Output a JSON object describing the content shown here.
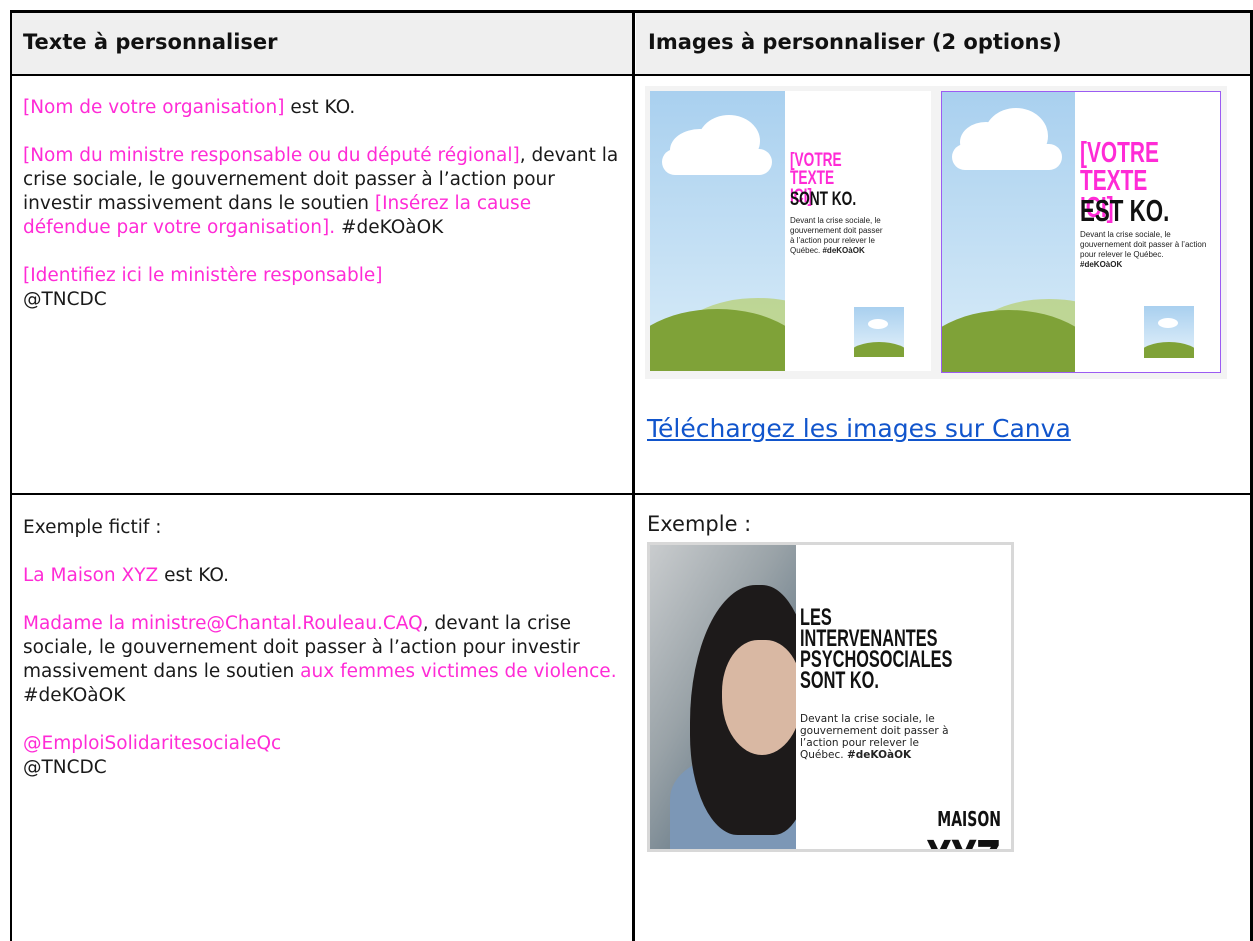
{
  "headers": {
    "left": "Texte à personnaliser",
    "right": "Images à personnaliser (2 options)"
  },
  "template_text": {
    "line1_placeholder": "[Nom de votre organisation]",
    "line1_rest": " est KO.",
    "p2_placeholder_a": "[Nom du ministre responsable ou du député régional]",
    "p2_text_a": ", devant la crise sociale, le gouvernement doit passer à l’action pour investir massivement dans le soutien ",
    "p2_placeholder_b": "[Insérez la cause défendue par votre organisation].",
    "p2_text_b": " #deKOàOK",
    "p3_placeholder": "[Identifiez ici le ministère responsable]",
    "p3_handle": "@TNCDC"
  },
  "option1": {
    "title_pink": "[VOTRE TEXTE ICI]",
    "title_black": "SONT KO.",
    "body": "Devant la crise sociale, le gouvernement doit passer à l’action pour relever le Québec.",
    "hashtag": "#deKOàOK"
  },
  "option2": {
    "title_pink": "[VOTRE TEXTE ICI]",
    "title_black": "EST KO.",
    "body": "Devant la crise sociale, le gouvernement doit passer à l’action pour relever le Québec.",
    "hashtag": "#deKOàOK"
  },
  "canva_link": "Téléchargez les images sur Canva",
  "example_text": {
    "intro": "Exemple fictif  :",
    "org": "La Maison XYZ ",
    "org_rest": " est KO.",
    "minister": "Madame la ministre@Chantal.Rouleau.CAQ",
    "p2_text": ", devant la crise sociale, le gouvernement doit passer à l’action pour investir massivement dans le soutien ",
    "cause": "aux femmes victimes de violence.",
    "hashtag": "#deKOàOK",
    "ministry": "@EmploiSolidaritesocialeQc",
    "handle": "@TNCDC"
  },
  "example_image": {
    "label": "Exemple :",
    "title": "LES INTERVENANTES PSYCHOSOCIALES SONT KO.",
    "body": "Devant la crise sociale, le gouvernement doit passer à l’action pour relever le Québec.",
    "hashtag": "#deKOàOK",
    "org_small": "MAISON",
    "org_large": "XYZ"
  },
  "colors": {
    "placeholder_pink": "#ff2bd6",
    "link_blue": "#1155cc",
    "header_bg": "#efefef"
  }
}
